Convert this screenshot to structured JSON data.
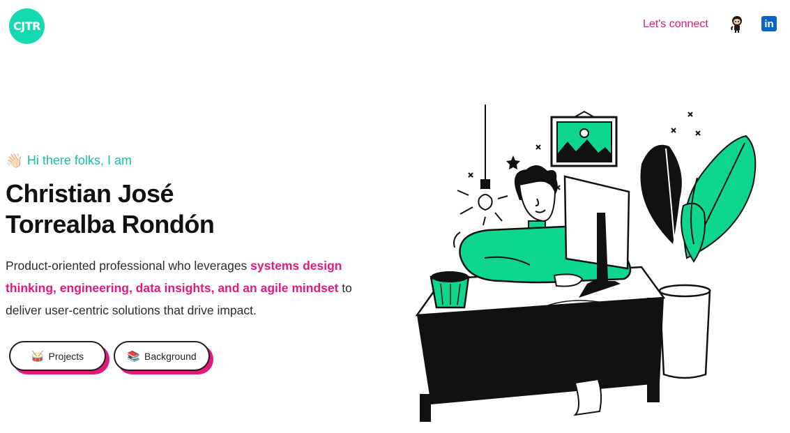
{
  "header": {
    "logo_text": "CJTR",
    "nav_connect": "Let's connect",
    "github_icon": "github-octocat-icon",
    "linkedin_icon": "linkedin-icon",
    "linkedin_text": "in"
  },
  "hero": {
    "wave_emoji": "👋🏻",
    "greeting": "Hi there folks, I am",
    "name_line1": "Christian José",
    "name_line2": "Torrealba Rondón",
    "tagline_pre": "Product-oriented professional who leverages ",
    "tagline_highlight": "systems design thinking, engineering, data insights, and an agile mindset",
    "tagline_post": " to deliver user-centric solutions that drive impact."
  },
  "buttons": {
    "projects_emoji": "🥁",
    "projects_label": "Projects",
    "background_emoji": "📚",
    "background_label": "Background"
  },
  "colors": {
    "accent_teal": "#14d9b1",
    "accent_pink": "#e4197c",
    "illustration_green": "#0fd68f"
  }
}
